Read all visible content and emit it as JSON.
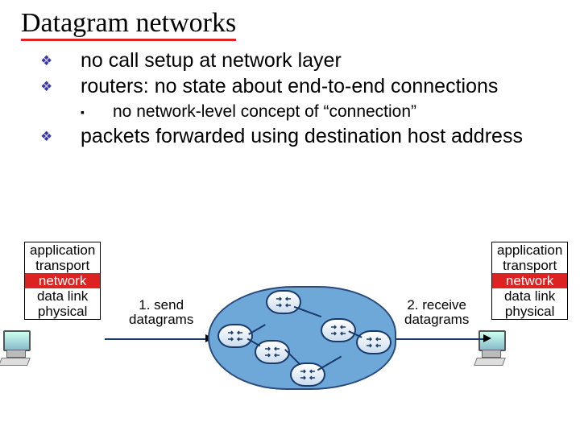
{
  "title": "Datagram networks",
  "bullets": {
    "items": [
      {
        "level": 1,
        "text": "no call setup at network layer"
      },
      {
        "level": 1,
        "text": "routers: no state about end-to-end connections"
      },
      {
        "level": 2,
        "text": "no network-level concept of “connection”"
      },
      {
        "level": 1,
        "text": "packets forwarded using destination host address"
      }
    ]
  },
  "stack": {
    "layers": [
      "application",
      "transport",
      "network",
      "data link",
      "physical"
    ],
    "highlight_index": 2
  },
  "captions": {
    "send": {
      "line1": "1. send",
      "line2": "datagrams"
    },
    "receive": {
      "line1": "2. receive",
      "line2": "datagrams"
    }
  },
  "markers": {
    "level1": "❖",
    "level2": "▪"
  }
}
